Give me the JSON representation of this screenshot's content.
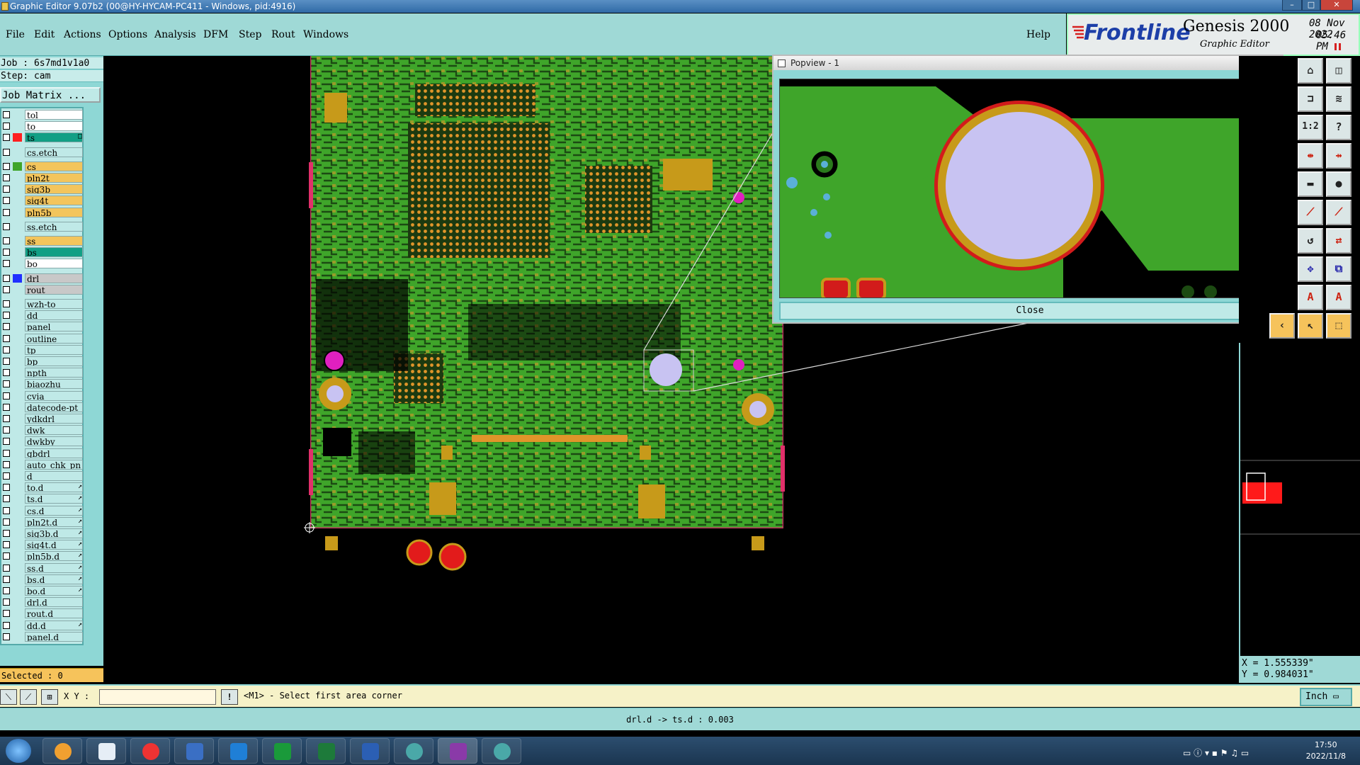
{
  "window": {
    "title": "Graphic Editor 9.07b2 (00@HY-HYCAM-PC411 - Windows, pid:4916)"
  },
  "menu": {
    "file": "File",
    "edit": "Edit",
    "actions": "Actions",
    "options": "Options",
    "analysis": "Analysis",
    "dfm": "DFM",
    "step": "Step",
    "rout": "Rout",
    "windows": "Windows",
    "help": "Help"
  },
  "branding": {
    "logo": "Frontline",
    "product": "Genesis 2000",
    "subtitle": "Graphic Editor",
    "date": "08 Nov 2022",
    "time": "05:46 PM"
  },
  "job": {
    "job": "Job : 6s7md1v1a0",
    "step": "Step: cam",
    "matrix_button": "Job Matrix ..."
  },
  "layers": [
    {
      "name": "tol",
      "color": "#ffffff",
      "swatch": ""
    },
    {
      "name": "to",
      "color": "#ffffff",
      "swatch": ""
    },
    {
      "name": "ts",
      "color": "#129f85",
      "swatch": "#ff2020",
      "marker": "□"
    },
    {
      "name": "cs.etch",
      "color": "#bfe9e7",
      "swatch": ""
    },
    {
      "name": "cs",
      "color": "#f3c55c",
      "swatch": "#3fa52a"
    },
    {
      "name": "pln2t",
      "color": "#f3c55c",
      "swatch": ""
    },
    {
      "name": "sig3b",
      "color": "#f3c55c",
      "swatch": ""
    },
    {
      "name": "sig4t",
      "color": "#f3c55c",
      "swatch": ""
    },
    {
      "name": "pln5b",
      "color": "#f3c55c",
      "swatch": ""
    },
    {
      "name": "ss.etch",
      "color": "#bfe9e7",
      "swatch": ""
    },
    {
      "name": "ss",
      "color": "#f3c55c",
      "swatch": ""
    },
    {
      "name": "bs",
      "color": "#129f85",
      "swatch": ""
    },
    {
      "name": "bo",
      "color": "#ffffff",
      "swatch": ""
    },
    {
      "name": "drl",
      "color": "#c8c8c8",
      "swatch": "#2030ff"
    },
    {
      "name": "rout",
      "color": "#c8c8c8",
      "swatch": ""
    },
    {
      "name": "wzh-to",
      "color": "#bfe9e7",
      "swatch": ""
    },
    {
      "name": "dd",
      "color": "#bfe9e7",
      "swatch": ""
    },
    {
      "name": "panel",
      "color": "#bfe9e7",
      "swatch": ""
    },
    {
      "name": "outline",
      "color": "#bfe9e7",
      "swatch": ""
    },
    {
      "name": "tp",
      "color": "#bfe9e7",
      "swatch": ""
    },
    {
      "name": "bp",
      "color": "#bfe9e7",
      "swatch": ""
    },
    {
      "name": "npth",
      "color": "#bfe9e7",
      "swatch": ""
    },
    {
      "name": "biaozhu",
      "color": "#bfe9e7",
      "swatch": ""
    },
    {
      "name": "cvia",
      "color": "#bfe9e7",
      "swatch": ""
    },
    {
      "name": "datecode-pt",
      "color": "#bfe9e7",
      "swatch": ""
    },
    {
      "name": "ydkdrl",
      "color": "#bfe9e7",
      "swatch": ""
    },
    {
      "name": "dwk",
      "color": "#bfe9e7",
      "swatch": ""
    },
    {
      "name": "dwkby",
      "color": "#bfe9e7",
      "swatch": ""
    },
    {
      "name": "gbdrl",
      "color": "#bfe9e7",
      "swatch": ""
    },
    {
      "name": "auto_chk_pn",
      "color": "#bfe9e7",
      "swatch": ""
    },
    {
      "name": "d",
      "color": "#bfe9e7",
      "swatch": ""
    },
    {
      "name": "to.d",
      "color": "#bfe9e7",
      "swatch": "",
      "marker": "↗"
    },
    {
      "name": "ts.d",
      "color": "#bfe9e7",
      "swatch": "",
      "marker": "↗"
    },
    {
      "name": "cs.d",
      "color": "#bfe9e7",
      "swatch": "",
      "marker": "↗"
    },
    {
      "name": "pln2t.d",
      "color": "#bfe9e7",
      "swatch": "",
      "marker": "↗"
    },
    {
      "name": "sig3b.d",
      "color": "#bfe9e7",
      "swatch": "",
      "marker": "↗"
    },
    {
      "name": "sig4t.d",
      "color": "#bfe9e7",
      "swatch": "",
      "marker": "↗"
    },
    {
      "name": "pln5b.d",
      "color": "#bfe9e7",
      "swatch": "",
      "marker": "↗"
    },
    {
      "name": "ss.d",
      "color": "#bfe9e7",
      "swatch": "",
      "marker": "↗"
    },
    {
      "name": "bs.d",
      "color": "#bfe9e7",
      "swatch": "",
      "marker": "↗"
    },
    {
      "name": "bo.d",
      "color": "#bfe9e7",
      "swatch": "",
      "marker": "↗"
    },
    {
      "name": "drl.d",
      "color": "#bfe9e7",
      "swatch": ""
    },
    {
      "name": "rout.d",
      "color": "#bfe9e7",
      "swatch": ""
    },
    {
      "name": "dd.d",
      "color": "#bfe9e7",
      "swatch": "",
      "marker": "↗"
    },
    {
      "name": "panel.d",
      "color": "#bfe9e7",
      "swatch": ""
    }
  ],
  "selected": "Selected : 0",
  "popview": {
    "title": "Popview - 1",
    "close_button": "Close"
  },
  "coords": {
    "x": "X = 1.555339\"",
    "y": "Y = 0.984031\""
  },
  "command": {
    "xy_label": "X Y :",
    "xy_value": "",
    "prompt": "<M1> - Select first area corner",
    "units": "Inch"
  },
  "info": "drl.d -> ts.d : 0.003",
  "taskbar": {
    "time": "17:50",
    "date": "2022/11/8"
  },
  "colors": {
    "board_green": "#3fa52a",
    "pad_gold": "#c79a1a",
    "copper_orange": "#e0952a",
    "hole_lavender": "#c8c3f2",
    "via_magenta": "#e020c0",
    "ui_teal": "#8ed7d5"
  }
}
